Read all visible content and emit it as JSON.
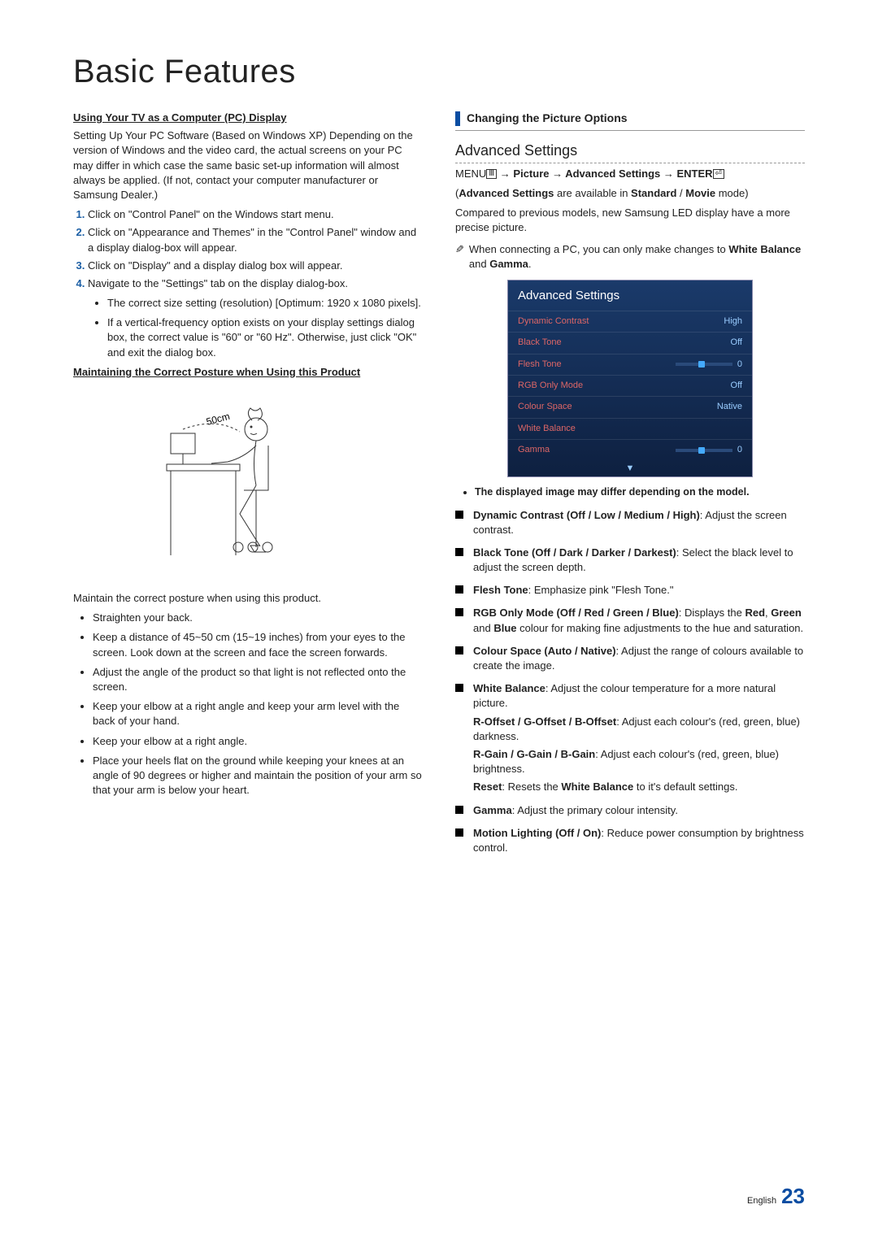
{
  "pageTitle": "Basic Features",
  "left": {
    "subheading1": "Using Your TV as a Computer (PC) Display",
    "para1": "Setting Up Your PC Software (Based on Windows XP) Depending on the version of Windows and the video card, the actual screens on your PC may differ in which case the same basic set-up information will almost always be applied. (If not, contact your computer manufacturer or Samsung Dealer.)",
    "steps": [
      "Click on \"Control Panel\" on the Windows start menu.",
      "Click on \"Appearance and Themes\" in the \"Control Panel\" window and a display dialog-box will appear.",
      "Click on \"Display\" and a display dialog box will appear.",
      "Navigate to the \"Settings\" tab on the display dialog-box."
    ],
    "subbullets4": [
      "The correct size setting (resolution) [Optimum: 1920 x 1080 pixels].",
      "If a vertical-frequency option exists on your display settings dialog box, the correct value is \"60\" or \"60 Hz\". Otherwise, just click \"OK\" and exit the dialog box."
    ],
    "subheading2": "Maintaining the Correct Posture when Using this Product",
    "postureLabel": "50cm",
    "postureIntro": "Maintain the correct posture when using this product.",
    "postureBullets": [
      "Straighten your back.",
      "Keep a distance of 45~50 cm (15~19 inches) from your eyes to the screen. Look down at the screen and face the screen forwards.",
      "Adjust the angle of the product so that light is not reflected onto the screen.",
      "Keep your elbow at a right angle and keep your arm level with the back of your hand.",
      "Keep your elbow at a right angle.",
      "Place your heels flat on the ground while keeping your knees at an angle of 90 degrees or higher and maintain the position of your arm so that your arm is below your heart."
    ]
  },
  "right": {
    "sectionLabel": "Changing the Picture Options",
    "h3": "Advanced Settings",
    "menuPathPrefix": "MENU",
    "menuPathText": " → Picture → Advanced Settings → ENTER",
    "availLine1a": "(",
    "availLine1b": "Advanced Settings",
    "availLine1c": " are available in ",
    "availLine1d": "Standard",
    "availLine1e": " / ",
    "availLine1f": "Movie",
    "availLine1g": " mode)",
    "para2": "Compared to previous models, new Samsung LED display have a more precise picture.",
    "noteText1": "When connecting a PC, you can only make changes to ",
    "noteBold1": "White Balance",
    "noteText2": " and ",
    "noteBold2": "Gamma",
    "noteText3": ".",
    "menu": {
      "header": "Advanced Settings",
      "rows": [
        {
          "label": "Dynamic Contrast",
          "value": "High",
          "type": "text"
        },
        {
          "label": "Black Tone",
          "value": "Off",
          "type": "text"
        },
        {
          "label": "Flesh Tone",
          "value": "0",
          "type": "slider"
        },
        {
          "label": "RGB Only Mode",
          "value": "Off",
          "type": "text"
        },
        {
          "label": "Colour Space",
          "value": "Native",
          "type": "text"
        },
        {
          "label": "White Balance",
          "value": "",
          "type": "text"
        },
        {
          "label": "Gamma",
          "value": "0",
          "type": "slider"
        }
      ],
      "arrow": "▼"
    },
    "bulletNote": "The displayed image may differ depending on the model.",
    "squares": [
      {
        "bold": "Dynamic Contrast (Off / Low / Medium / High)",
        "text": ": Adjust the screen contrast."
      },
      {
        "bold": "Black Tone (Off / Dark / Darker / Darkest)",
        "text": ": Select the black level to adjust the screen depth."
      },
      {
        "bold": "Flesh Tone",
        "text": ": Emphasize pink \"Flesh Tone.\""
      },
      {
        "bold": "RGB Only Mode (Off / Red / Green / Blue)",
        "text_parts": [
          ": Displays the ",
          {
            "b": "Red"
          },
          ", ",
          {
            "b": "Green"
          },
          " and ",
          {
            "b": "Blue"
          },
          " colour for making fine adjustments to the hue and saturation."
        ]
      },
      {
        "bold": "Colour Space (Auto / Native)",
        "text": ": Adjust the range of colours available to create the image."
      },
      {
        "bold": "White Balance",
        "text": ": Adjust the colour temperature for a more natural picture.",
        "subparas": [
          {
            "b": "R-Offset / G-Offset / B-Offset",
            "t": ": Adjust each colour's (red, green, blue) darkness."
          },
          {
            "b": "R-Gain / G-Gain / B-Gain",
            "t": ": Adjust each colour's (red, green, blue) brightness."
          },
          {
            "b": "Reset",
            "t_parts": [
              ": Resets the ",
              {
                "b": "White Balance"
              },
              " to it's default settings."
            ]
          }
        ]
      },
      {
        "bold": "Gamma",
        "text": ": Adjust the primary colour intensity."
      },
      {
        "bold": "Motion Lighting (Off / On)",
        "text": ": Reduce power consumption by brightness control."
      }
    ]
  },
  "footer": {
    "lang": "English",
    "page": "23"
  }
}
